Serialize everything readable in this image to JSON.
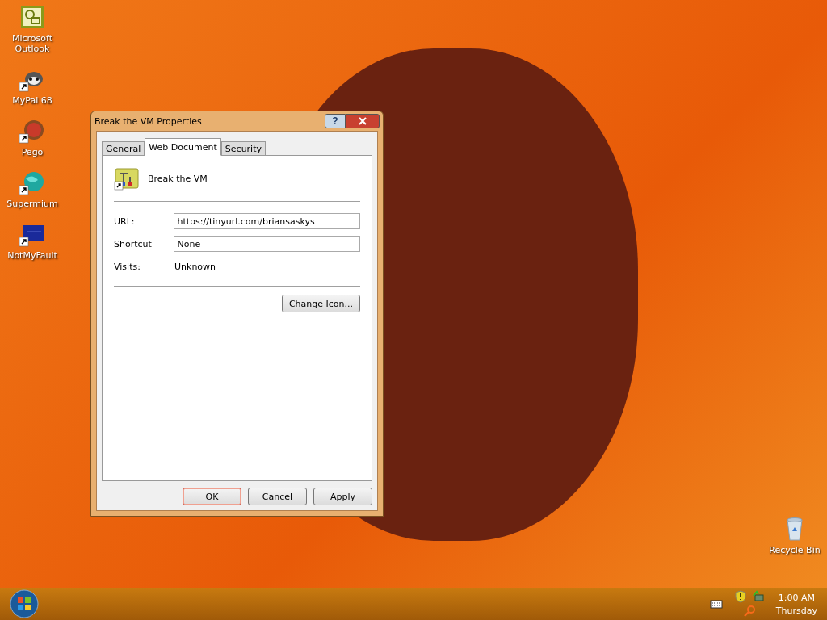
{
  "desktop_icons": [
    {
      "label": "Microsoft Outlook",
      "shortcut": false
    },
    {
      "label": "MyPal 68",
      "shortcut": true
    },
    {
      "label": "Pego",
      "shortcut": true
    },
    {
      "label": "Supermium",
      "shortcut": true
    },
    {
      "label": "NotMyFault",
      "shortcut": true
    }
  ],
  "recycle_bin": {
    "label": "Recycle Bin"
  },
  "dialog": {
    "title": "Break the VM Properties",
    "help": "?",
    "tabs": [
      {
        "label": "General",
        "selected": false
      },
      {
        "label": "Web Document",
        "selected": true
      },
      {
        "label": "Security",
        "selected": false
      }
    ],
    "item_name": "Break the VM",
    "fields": [
      {
        "label": "URL:",
        "value": "https://tinyurl.com/briansaskys",
        "kind": "input"
      },
      {
        "label": "Shortcut",
        "value": "None",
        "kind": "input"
      },
      {
        "label": "Visits:",
        "value": "Unknown",
        "kind": "text"
      }
    ],
    "change_icon": "Change Icon...",
    "buttons": [
      {
        "label": "OK",
        "default": true
      },
      {
        "label": "Cancel",
        "default": false
      },
      {
        "label": "Apply",
        "default": false
      }
    ]
  },
  "taskbar": {
    "time": "1:00 AM",
    "day": "Thursday"
  }
}
